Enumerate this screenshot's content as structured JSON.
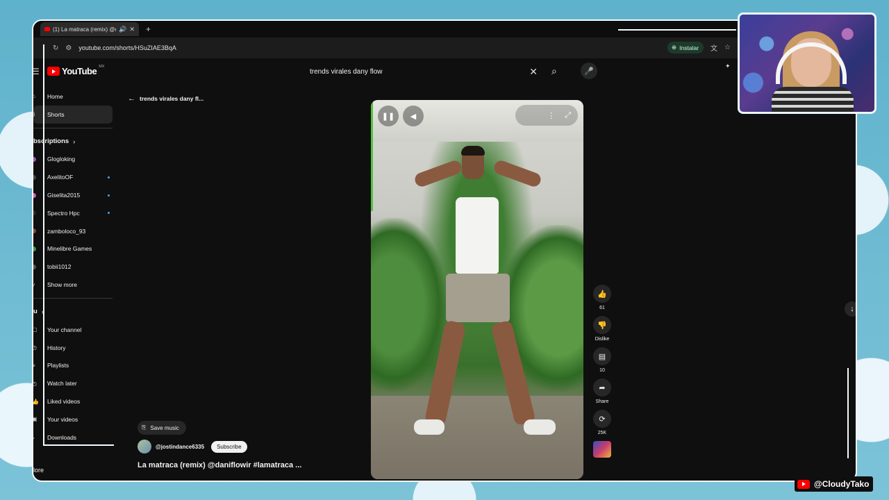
{
  "browser": {
    "tab_title": "(1) La matraca (remix) @dai",
    "url": "youtube.com/shorts/HSuZIAE3BqA",
    "install_label": "Instalar"
  },
  "youtube": {
    "logo_text": "YouTube",
    "region": "MX",
    "search_query": "trends virales dany flow"
  },
  "sidebar": {
    "main": [
      {
        "label": "Home",
        "icon": "home-icon"
      },
      {
        "label": "Shorts",
        "icon": "shorts-icon",
        "active": true
      }
    ],
    "subscriptions_title": "bscriptions",
    "subscriptions": [
      {
        "label": "Glogloking",
        "avatar_color": "#9b59b6",
        "new": false
      },
      {
        "label": "AxelitoOF",
        "avatar_color": "#444444",
        "new": true
      },
      {
        "label": "Giselita2015",
        "avatar_color": "#d35fb7",
        "new": true
      },
      {
        "label": "Spectro Hpc",
        "avatar_color": "#2b2b2b",
        "new": true
      },
      {
        "label": "zamboloco_93",
        "avatar_color": "#7a4f3a",
        "new": false
      },
      {
        "label": "Minelibre Games",
        "avatar_color": "#3b9b3b",
        "new": false
      },
      {
        "label": "tobii1012",
        "avatar_color": "#555555",
        "new": false
      }
    ],
    "show_more": "Show more",
    "you_title": "u",
    "you_items": [
      {
        "label": "Your channel"
      },
      {
        "label": "History"
      },
      {
        "label": "Playlists"
      },
      {
        "label": "Watch later"
      },
      {
        "label": "Liked videos"
      },
      {
        "label": "Your videos"
      },
      {
        "label": "Downloads"
      }
    ],
    "more": "lore"
  },
  "shorts_page": {
    "back_label": "trends virales dany fl...",
    "save_music": "Save music",
    "channel_handle": "@jostindance6335",
    "subscribe_label": "Subscribe",
    "title": "La matraca (remix) @daniflowir #lamatraca ..."
  },
  "actions": {
    "like_count": "61",
    "dislike_label": "Dislike",
    "comment_count": "10",
    "share_label": "Share",
    "remix_count": "25K"
  },
  "overlay": {
    "handle": "@CloudyTako"
  }
}
